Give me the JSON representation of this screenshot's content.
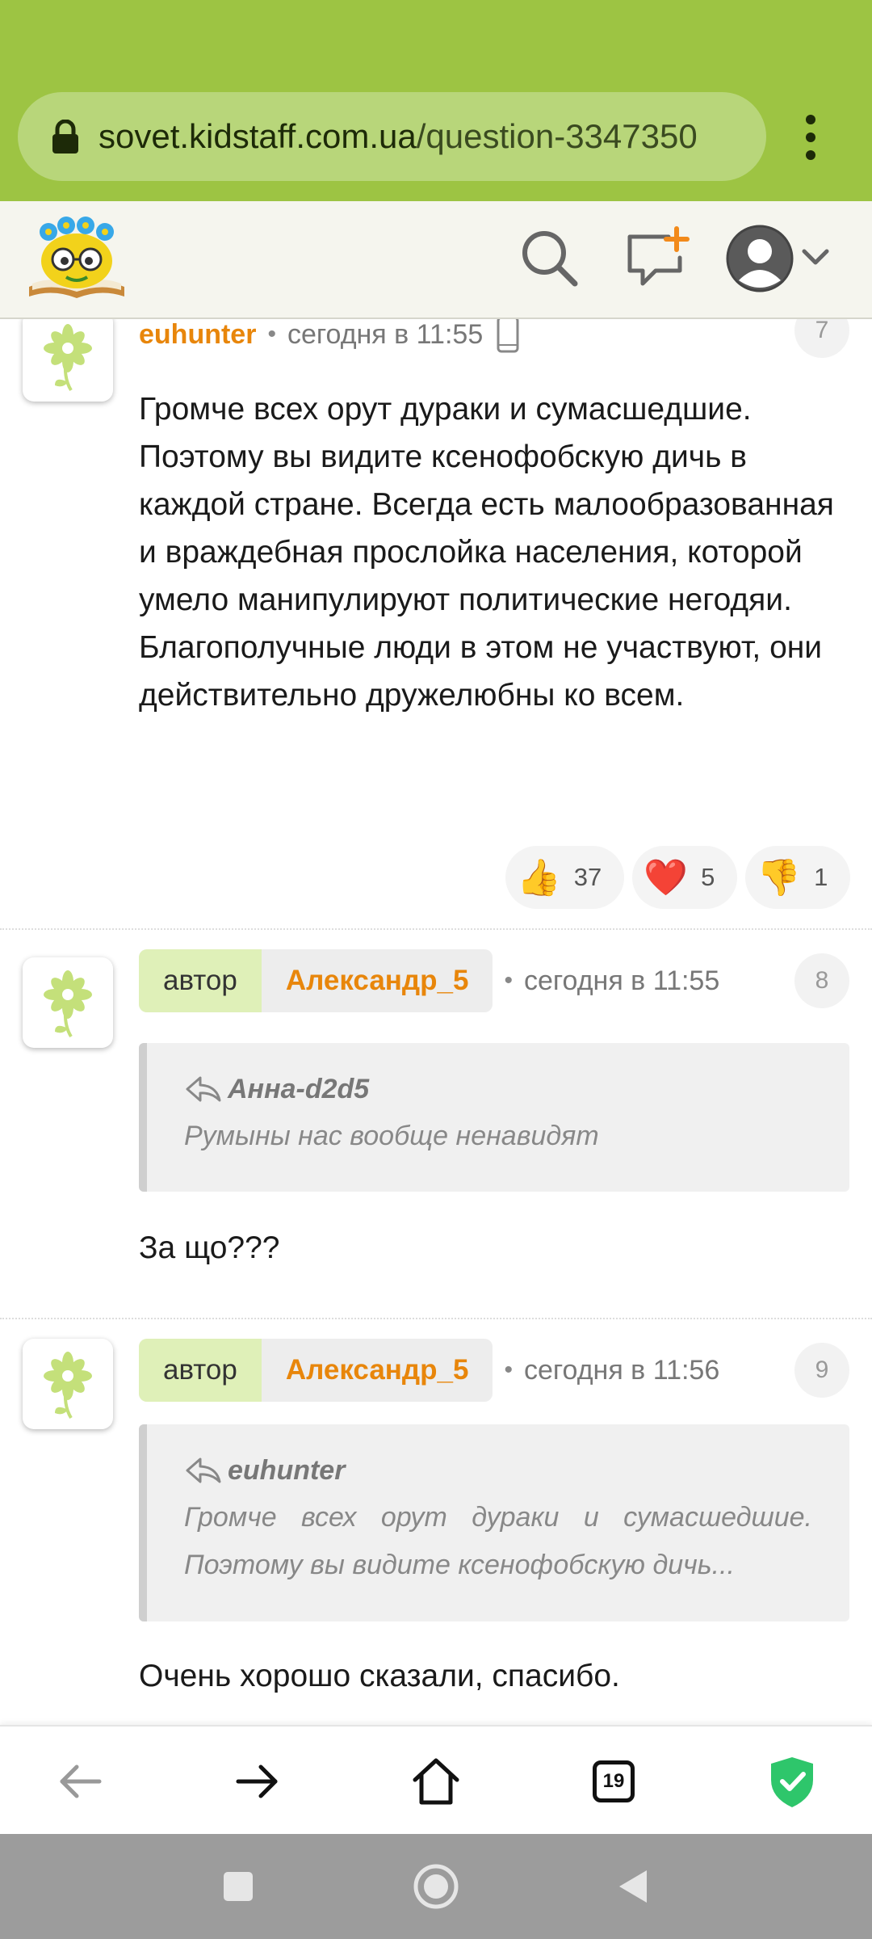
{
  "browser": {
    "url_host": "sovet.kidstaff.com.ua",
    "url_path": "/question-3347350",
    "tab_count": "19"
  },
  "site_header": {
    "logo_icon": "kidstaff-logo-icon",
    "icons": [
      "search-icon",
      "new-question-icon",
      "user-avatar-icon",
      "chevron-down-icon"
    ]
  },
  "comments": [
    {
      "author": "euhunter",
      "is_topic_author": false,
      "time": "сегодня в 11:55",
      "device_icon": "mobile-phone-icon",
      "number": "7",
      "text": "Громче всех орут дураки и сумасшедшие. Поэтому вы видите ксенофобскую дичь в каждой стране. Всегда есть малообразованная и враждебная прослойка населения, которой умело манипулируют политические негодяи. Благополучные люди в этом не участвуют, они действительно дружелюбны ко всем.",
      "reactions": [
        {
          "emoji": "👍",
          "count": "37",
          "name": "thumbs-up"
        },
        {
          "emoji": "❤️",
          "count": "5",
          "name": "heart"
        },
        {
          "emoji": "👎",
          "count": "1",
          "name": "thumbs-down"
        }
      ]
    },
    {
      "author_role": "автор",
      "author": "Александр_5",
      "is_topic_author": true,
      "time": "сегодня в 11:55",
      "number": "8",
      "quote": {
        "author": "Анна-d2d5",
        "text": "Румыны нас вообще ненавидят"
      },
      "text": "За що???"
    },
    {
      "author_role": "автор",
      "author": "Александр_5",
      "is_topic_author": true,
      "time": "сегодня в 11:56",
      "number": "9",
      "quote": {
        "author": "euhunter",
        "text_line1": "Громче всех орут дураки и сумасшедшие.",
        "text_line2": "Поэтому вы видите ксенофобскую дичь..."
      },
      "text": "Очень хорошо сказали, спасибо."
    }
  ],
  "colors": {
    "browser_bar": "#9dc443",
    "author_name": "#e8860b",
    "author_role_chip": "#dff0b8",
    "shield": "#2ec66b"
  }
}
